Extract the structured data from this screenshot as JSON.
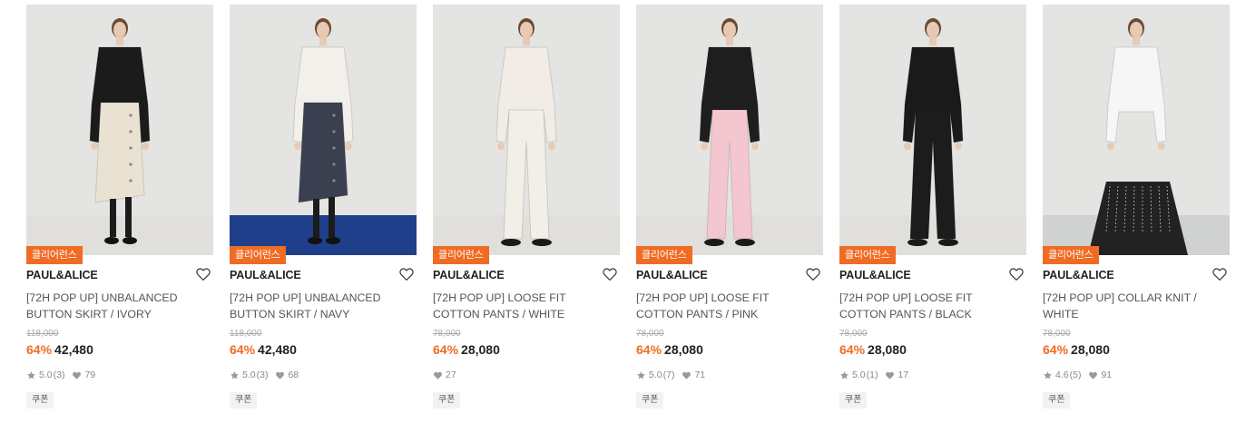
{
  "products": [
    {
      "badge": "클리어런스",
      "brand": "PAUL&ALICE",
      "name": "[72H POP UP] UNBALANCED BUTTON SKIRT / IVORY",
      "original_price": "118,000",
      "discount": "64%",
      "price": "42,480",
      "rating": "5.0",
      "review_count": "(3)",
      "likes": "79",
      "coupon": "쿠폰",
      "top_color": "#1b1b1b",
      "bottom_color": "#e9e2d2",
      "bottom_type": "skirt",
      "floor_color": "#e0dfdc"
    },
    {
      "badge": "클리어런스",
      "brand": "PAUL&ALICE",
      "name": "[72H POP UP] UNBALANCED BUTTON SKIRT / NAVY",
      "original_price": "118,000",
      "discount": "64%",
      "price": "42,480",
      "rating": "5.0",
      "review_count": "(3)",
      "likes": "68",
      "coupon": "쿠폰",
      "top_color": "#f3f0ec",
      "bottom_color": "#3b4050",
      "bottom_type": "skirt",
      "floor_color": "#1f3f8a"
    },
    {
      "badge": "클리어런스",
      "brand": "PAUL&ALICE",
      "name": "[72H POP UP] LOOSE FIT COTTON PANTS / WHITE",
      "original_price": "78,000",
      "discount": "64%",
      "price": "28,080",
      "rating": "",
      "review_count": "",
      "likes": "27",
      "coupon": "쿠폰",
      "top_color": "#f1ede6",
      "bottom_color": "#f2efe8",
      "bottom_type": "pants",
      "floor_color": "#e0dfdc"
    },
    {
      "badge": "클리어런스",
      "brand": "PAUL&ALICE",
      "name": "[72H POP UP] LOOSE FIT COTTON PANTS / PINK",
      "original_price": "78,000",
      "discount": "64%",
      "price": "28,080",
      "rating": "5.0",
      "review_count": "(7)",
      "likes": "71",
      "coupon": "쿠폰",
      "top_color": "#1e1e1e",
      "bottom_color": "#f4c6cf",
      "bottom_type": "pants",
      "floor_color": "#e0dfdc"
    },
    {
      "badge": "클리어런스",
      "brand": "PAUL&ALICE",
      "name": "[72H POP UP] LOOSE FIT COTTON PANTS / BLACK",
      "original_price": "78,000",
      "discount": "64%",
      "price": "28,080",
      "rating": "5.0",
      "review_count": "(1)",
      "likes": "17",
      "coupon": "쿠폰",
      "top_color": "#1a1a1a",
      "bottom_color": "#1c1c1c",
      "bottom_type": "pants",
      "floor_color": "#e0dfdc"
    },
    {
      "badge": "클리어런스",
      "brand": "PAUL&ALICE",
      "name": "[72H POP UP] COLLAR KNIT / WHITE",
      "original_price": "78,000",
      "discount": "64%",
      "price": "28,080",
      "rating": "4.6",
      "review_count": "(5)",
      "likes": "91",
      "coupon": "쿠폰",
      "top_color": "#f6f6f6",
      "bottom_color": "#222222",
      "bottom_type": "pleated",
      "floor_color": "#cfd2d0"
    }
  ],
  "icons": {
    "wishlist": "heart-outline-icon",
    "rating": "star-icon",
    "likes": "heart-filled-icon"
  },
  "colors": {
    "accent": "#f06b23",
    "text": "#222222",
    "muted": "#888888"
  }
}
